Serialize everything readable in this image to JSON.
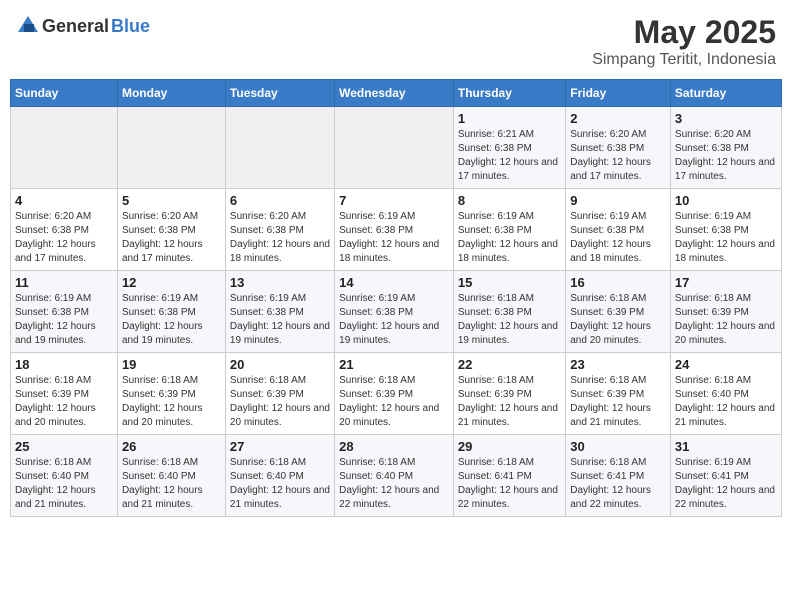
{
  "logo": {
    "general": "General",
    "blue": "Blue"
  },
  "title": "May 2025",
  "subtitle": "Simpang Teritit, Indonesia",
  "days_of_week": [
    "Sunday",
    "Monday",
    "Tuesday",
    "Wednesday",
    "Thursday",
    "Friday",
    "Saturday"
  ],
  "weeks": [
    [
      {
        "num": "",
        "info": ""
      },
      {
        "num": "",
        "info": ""
      },
      {
        "num": "",
        "info": ""
      },
      {
        "num": "",
        "info": ""
      },
      {
        "num": "1",
        "info": "Sunrise: 6:21 AM\nSunset: 6:38 PM\nDaylight: 12 hours and 17 minutes."
      },
      {
        "num": "2",
        "info": "Sunrise: 6:20 AM\nSunset: 6:38 PM\nDaylight: 12 hours and 17 minutes."
      },
      {
        "num": "3",
        "info": "Sunrise: 6:20 AM\nSunset: 6:38 PM\nDaylight: 12 hours and 17 minutes."
      }
    ],
    [
      {
        "num": "4",
        "info": "Sunrise: 6:20 AM\nSunset: 6:38 PM\nDaylight: 12 hours and 17 minutes."
      },
      {
        "num": "5",
        "info": "Sunrise: 6:20 AM\nSunset: 6:38 PM\nDaylight: 12 hours and 17 minutes."
      },
      {
        "num": "6",
        "info": "Sunrise: 6:20 AM\nSunset: 6:38 PM\nDaylight: 12 hours and 18 minutes."
      },
      {
        "num": "7",
        "info": "Sunrise: 6:19 AM\nSunset: 6:38 PM\nDaylight: 12 hours and 18 minutes."
      },
      {
        "num": "8",
        "info": "Sunrise: 6:19 AM\nSunset: 6:38 PM\nDaylight: 12 hours and 18 minutes."
      },
      {
        "num": "9",
        "info": "Sunrise: 6:19 AM\nSunset: 6:38 PM\nDaylight: 12 hours and 18 minutes."
      },
      {
        "num": "10",
        "info": "Sunrise: 6:19 AM\nSunset: 6:38 PM\nDaylight: 12 hours and 18 minutes."
      }
    ],
    [
      {
        "num": "11",
        "info": "Sunrise: 6:19 AM\nSunset: 6:38 PM\nDaylight: 12 hours and 19 minutes."
      },
      {
        "num": "12",
        "info": "Sunrise: 6:19 AM\nSunset: 6:38 PM\nDaylight: 12 hours and 19 minutes."
      },
      {
        "num": "13",
        "info": "Sunrise: 6:19 AM\nSunset: 6:38 PM\nDaylight: 12 hours and 19 minutes."
      },
      {
        "num": "14",
        "info": "Sunrise: 6:19 AM\nSunset: 6:38 PM\nDaylight: 12 hours and 19 minutes."
      },
      {
        "num": "15",
        "info": "Sunrise: 6:18 AM\nSunset: 6:38 PM\nDaylight: 12 hours and 19 minutes."
      },
      {
        "num": "16",
        "info": "Sunrise: 6:18 AM\nSunset: 6:39 PM\nDaylight: 12 hours and 20 minutes."
      },
      {
        "num": "17",
        "info": "Sunrise: 6:18 AM\nSunset: 6:39 PM\nDaylight: 12 hours and 20 minutes."
      }
    ],
    [
      {
        "num": "18",
        "info": "Sunrise: 6:18 AM\nSunset: 6:39 PM\nDaylight: 12 hours and 20 minutes."
      },
      {
        "num": "19",
        "info": "Sunrise: 6:18 AM\nSunset: 6:39 PM\nDaylight: 12 hours and 20 minutes."
      },
      {
        "num": "20",
        "info": "Sunrise: 6:18 AM\nSunset: 6:39 PM\nDaylight: 12 hours and 20 minutes."
      },
      {
        "num": "21",
        "info": "Sunrise: 6:18 AM\nSunset: 6:39 PM\nDaylight: 12 hours and 20 minutes."
      },
      {
        "num": "22",
        "info": "Sunrise: 6:18 AM\nSunset: 6:39 PM\nDaylight: 12 hours and 21 minutes."
      },
      {
        "num": "23",
        "info": "Sunrise: 6:18 AM\nSunset: 6:39 PM\nDaylight: 12 hours and 21 minutes."
      },
      {
        "num": "24",
        "info": "Sunrise: 6:18 AM\nSunset: 6:40 PM\nDaylight: 12 hours and 21 minutes."
      }
    ],
    [
      {
        "num": "25",
        "info": "Sunrise: 6:18 AM\nSunset: 6:40 PM\nDaylight: 12 hours and 21 minutes."
      },
      {
        "num": "26",
        "info": "Sunrise: 6:18 AM\nSunset: 6:40 PM\nDaylight: 12 hours and 21 minutes."
      },
      {
        "num": "27",
        "info": "Sunrise: 6:18 AM\nSunset: 6:40 PM\nDaylight: 12 hours and 21 minutes."
      },
      {
        "num": "28",
        "info": "Sunrise: 6:18 AM\nSunset: 6:40 PM\nDaylight: 12 hours and 22 minutes."
      },
      {
        "num": "29",
        "info": "Sunrise: 6:18 AM\nSunset: 6:41 PM\nDaylight: 12 hours and 22 minutes."
      },
      {
        "num": "30",
        "info": "Sunrise: 6:18 AM\nSunset: 6:41 PM\nDaylight: 12 hours and 22 minutes."
      },
      {
        "num": "31",
        "info": "Sunrise: 6:19 AM\nSunset: 6:41 PM\nDaylight: 12 hours and 22 minutes."
      }
    ]
  ]
}
